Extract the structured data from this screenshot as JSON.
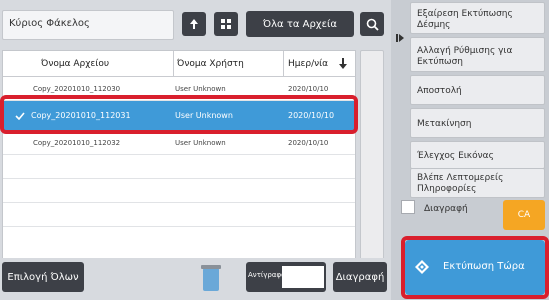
{
  "header": {
    "folder_title": "Κύριος Φάκελος",
    "all_files_button": "Όλα τα Αρχεία"
  },
  "table": {
    "columns": [
      "Όνομα Αρχείου",
      "Όνομα Χρήστη",
      "Ημερ/νία"
    ],
    "rows": [
      {
        "file": "Copy_20201010_112030",
        "user": "User Unknown",
        "date": "2020/10/10",
        "selected": false
      },
      {
        "file": "Copy_20201010_112031",
        "user": "User Unknown",
        "date": "2020/10/10",
        "selected": true
      },
      {
        "file": "Copy_20201010_112032",
        "user": "User Unknown",
        "date": "2020/10/10",
        "selected": false
      }
    ]
  },
  "bottom": {
    "select_all": "Επιλογή Όλων",
    "copies_label": "Αντίγραφα",
    "copies_value": "",
    "delete_button": "Διαγραφή"
  },
  "side_menu": {
    "items": [
      "Εξαίρεση Εκτύπωσης Δέσμης",
      "Αλλαγή Ρύθμισης για Εκτύπωση",
      "Αποστολή",
      "Μετακίνηση",
      "Έλεγχος Εικόνας",
      "Βλέπε Λεπτομερείς Πληροφορίες"
    ],
    "delete_checkbox_label": "Διαγραφή",
    "ca_button": "CA",
    "print_now_button": "Εκτύπωση Τώρα"
  },
  "colors": {
    "selection": "#3f9ad8",
    "highlight_border": "#d91f2d",
    "ca_button": "#f5a623",
    "dark_button": "#3d4047"
  }
}
